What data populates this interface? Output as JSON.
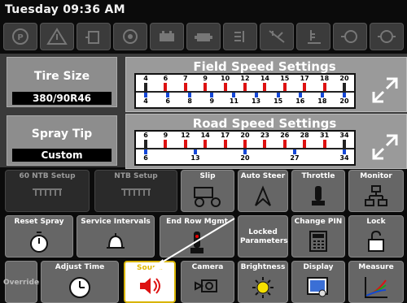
{
  "header": {
    "datetime": "Tuesday 09:36 AM"
  },
  "status_icons": [
    "park-icon",
    "warning-icon",
    "fuel-icon",
    "steering-icon",
    "battery-icon",
    "engine-icon",
    "coolant-icon",
    "hydraulic-icon",
    "oil-temp-icon",
    "filter-icon",
    "transmission-icon"
  ],
  "tire": {
    "label": "Tire Size",
    "value": "380/90R46"
  },
  "spray": {
    "label": "Spray Tip",
    "value": "Custom"
  },
  "field": {
    "title": "Field Speed Settings",
    "top_ticks": [
      "4",
      "6",
      "7",
      "9",
      "10",
      "12",
      "14",
      "15",
      "17",
      "18",
      "20"
    ],
    "bottom_ticks": [
      "4",
      "6",
      "8",
      "9",
      "11",
      "13",
      "15",
      "16",
      "18",
      "20"
    ]
  },
  "road": {
    "title": "Road Speed Settings",
    "top_ticks": [
      "6",
      "9",
      "12",
      "14",
      "17",
      "20",
      "23",
      "26",
      "28",
      "31",
      "34"
    ],
    "bottom_ticks": [
      "6",
      "13",
      "20",
      "27",
      "34"
    ]
  },
  "buttons": {
    "ntb60": "60 NTB Setup",
    "ntb": "NTB Setup",
    "slip": "Slip",
    "auto_steer": "Auto Steer",
    "throttle": "Throttle",
    "monitor": "Monitor",
    "reset_spray": "Reset Spray",
    "service": "Service Intervals",
    "end_row": "End Row Mgmt",
    "locked": "Locked Parameters",
    "change_pin": "Change PIN",
    "lock": "Lock",
    "override": "Override",
    "adjust_time": "Adjust Time",
    "sound": "Sound",
    "camera": "Camera",
    "brightness": "Brightness",
    "display": "Display",
    "measure": "Measure"
  },
  "colors": {
    "accent": "#e0b800",
    "tick_red": "#d11",
    "tick_blue": "#1447d6"
  }
}
